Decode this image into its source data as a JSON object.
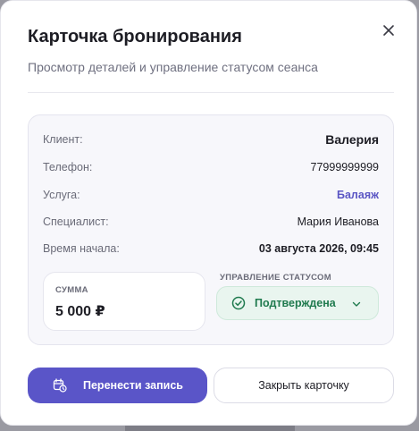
{
  "modal": {
    "title": "Карточка бронирования",
    "subtitle": "Просмотр деталей и управление статусом сеанса",
    "close_icon": "close-icon"
  },
  "details": {
    "client_label": "Клиент:",
    "client_value": "Валерия",
    "phone_label": "Телефон:",
    "phone_value": "77999999999",
    "service_label": "Услуга:",
    "service_value": "Балаяж",
    "specialist_label": "Специалист:",
    "specialist_value": "Мария Иванова",
    "start_label": "Время начала:",
    "start_value": "03 августа 2026, 09:45"
  },
  "sum": {
    "caption": "СУММА",
    "amount": "5 000 ₽"
  },
  "status": {
    "caption": "УПРАВЛЕНИЕ СТАТУСОМ",
    "value": "Подтверждена",
    "icon": "check-circle-icon",
    "dropdown_icon": "chevron-down-icon"
  },
  "actions": {
    "reschedule_label": "Перенести запись",
    "reschedule_icon": "calendar-clock-icon",
    "close_label": "Закрыть карточку"
  },
  "colors": {
    "accent": "#5a55c8",
    "status_text": "#1f7a4e",
    "status_bg": "#e9f5ef"
  }
}
